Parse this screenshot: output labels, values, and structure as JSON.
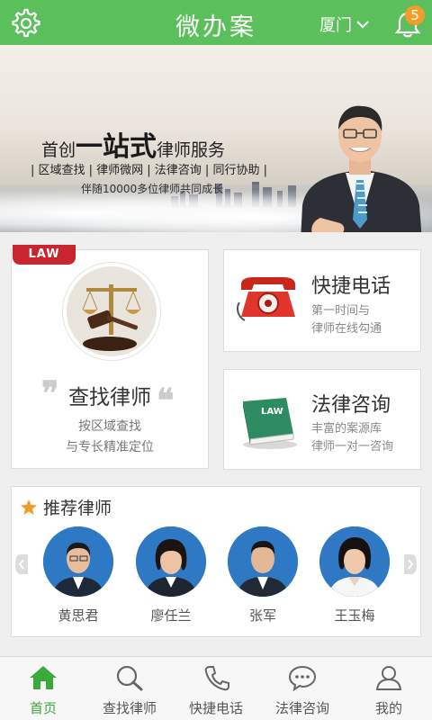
{
  "header": {
    "title": "微办案",
    "city": "厦门",
    "notification_count": "5"
  },
  "banner": {
    "headline_pre": "首创",
    "headline_big": "一站式",
    "headline_post": "律师服务",
    "tags": "| 区域查找 | 律师微网 | 法律咨询 | 同行协助 |",
    "subline": "伴随10000多位律师共同成长"
  },
  "cards": {
    "find_lawyer": {
      "badge": "LAW",
      "title": "查找律师",
      "line1": "按区域查找",
      "line2": "与专长精准定位"
    },
    "quick_call": {
      "title": "快捷电话",
      "line1": "第一时间与",
      "line2": "律师在线勾通"
    },
    "legal_consult": {
      "title": "法律咨询",
      "line1": "丰富的案源库",
      "line2": "律师一对一咨询",
      "book_label": "LAW"
    }
  },
  "recommend": {
    "title": "推荐律师",
    "lawyers": [
      {
        "name": "黄思君"
      },
      {
        "name": "廖任兰"
      },
      {
        "name": "张军"
      },
      {
        "name": "王玉梅"
      }
    ]
  },
  "tabs": [
    {
      "label": "首页",
      "icon": "home-icon",
      "active": true
    },
    {
      "label": "查找律师",
      "icon": "search-icon",
      "active": false
    },
    {
      "label": "快捷电话",
      "icon": "phone-icon",
      "active": false
    },
    {
      "label": "法律咨询",
      "icon": "chat-icon",
      "active": false
    },
    {
      "label": "我的",
      "icon": "user-icon",
      "active": false
    }
  ],
  "colors": {
    "brand_green": "#5bbf5b",
    "active_tab": "#3aaa3a",
    "badge_orange": "#f29d2a",
    "law_red": "#c8252e"
  }
}
